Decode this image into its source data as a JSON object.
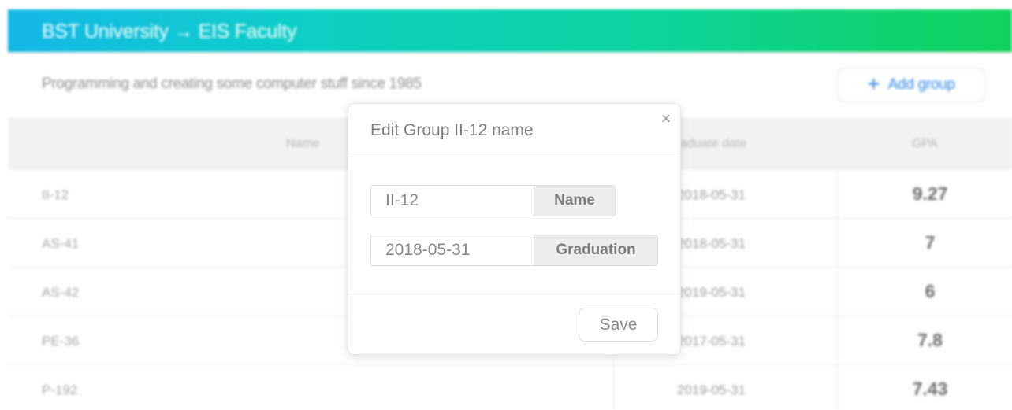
{
  "header": {
    "title": "BST University → EIS Faculty"
  },
  "subtitle": "Programming and creating some computer stuff since 1985",
  "add_group": {
    "icon": "plus-icon",
    "label": "Add group",
    "color": "#2f86e6"
  },
  "table": {
    "columns": [
      "Name",
      "Graduate date",
      "GPA"
    ],
    "rows": [
      {
        "name": "II-12",
        "graduate_date": "2018-05-31",
        "gpa": "9.27"
      },
      {
        "name": "AS-41",
        "graduate_date": "2018-05-31",
        "gpa": "7"
      },
      {
        "name": "AS-42",
        "graduate_date": "2019-05-31",
        "gpa": "6"
      },
      {
        "name": "PE-36",
        "graduate_date": "2017-05-31",
        "gpa": "7.8"
      },
      {
        "name": "P-192",
        "graduate_date": "2019-05-31",
        "gpa": "7.43"
      }
    ]
  },
  "modal": {
    "title": "Edit Group II-12 name",
    "close_icon": "close-icon",
    "name_field": {
      "value": "II-12",
      "addon": "Name"
    },
    "graduation_field": {
      "value": "2018-05-31",
      "addon": "Graduation"
    },
    "save_label": "Save"
  },
  "colors": {
    "header_gradient_start": "#14b7e6",
    "header_gradient_end": "#10d25a",
    "accent": "#2f86e6"
  }
}
